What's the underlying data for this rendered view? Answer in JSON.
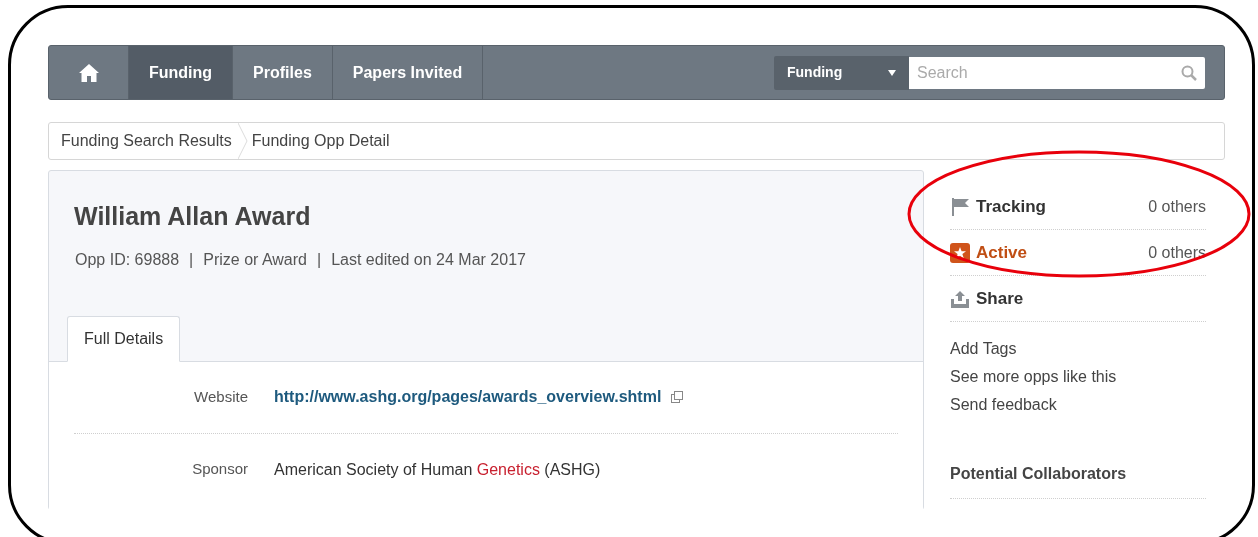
{
  "navbar": {
    "items": [
      {
        "kind": "home",
        "selected": false
      },
      {
        "label": "Funding",
        "selected": true
      },
      {
        "label": "Profiles",
        "selected": false
      },
      {
        "label": "Papers Invited",
        "selected": false
      }
    ],
    "search": {
      "category": "Funding",
      "placeholder": "Search"
    }
  },
  "breadcrumb": [
    "Funding Search Results",
    "Funding Opp Detail"
  ],
  "opportunity": {
    "title": "William Allan Award",
    "meta": [
      "Opp ID: 69888",
      "|",
      "Prize or Award",
      "|",
      "Last edited on 24 Mar 2017"
    ]
  },
  "tabs": [
    {
      "label": "Full Details",
      "selected": true
    }
  ],
  "details": [
    {
      "label": "Website",
      "value": "http://www.ashg.org/pages/awards_overview.shtml",
      "kind": "link"
    },
    {
      "label": "Sponsor",
      "kind": "text",
      "parts": [
        {
          "text": "American Society of Human ",
          "kind": "plain"
        },
        {
          "text": "Genetics",
          "kind": "term"
        },
        {
          "text": " (ASHG)",
          "kind": "plain"
        }
      ]
    }
  ],
  "sidebar": {
    "actions": [
      {
        "kind": "tracking",
        "label": "Tracking",
        "count": "0 others"
      },
      {
        "kind": "active",
        "label": "Active",
        "count": "0 others"
      },
      {
        "kind": "share",
        "label": "Share"
      }
    ],
    "links": [
      "Add Tags",
      "See more opps like this",
      "Send feedback"
    ],
    "section_title": "Potential Collaborators"
  }
}
